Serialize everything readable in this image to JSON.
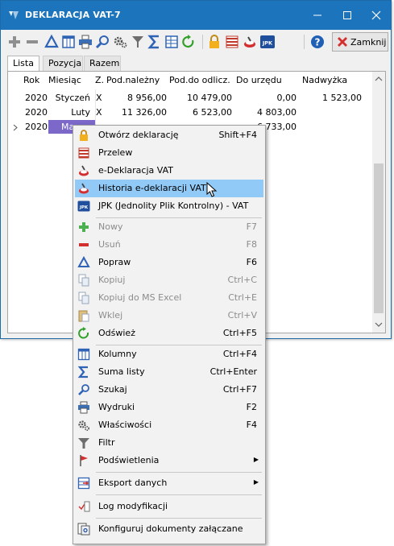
{
  "window": {
    "title": "DEKLARACJA VAT-7",
    "close_label": "Zamknij"
  },
  "tabs": [
    "Lista",
    "Pozycja",
    "Razem"
  ],
  "grid": {
    "columns": [
      "Rok",
      "Miesiąc",
      "Z.",
      "Pod.należny",
      "Pod.do odlicz.",
      "Do urzędu",
      "Nadwyżka"
    ],
    "rows": [
      [
        "2020",
        "Styczeń",
        "X",
        "8 956,00",
        "10 479,00",
        "0,00",
        "1 523,00"
      ],
      [
        "2020",
        "Luty",
        "X",
        "11 326,00",
        "6 523,00",
        "4 803,00",
        ""
      ],
      [
        "2020",
        "Ma",
        "",
        "",
        "",
        "6 733,00",
        ""
      ]
    ]
  },
  "context_menu": {
    "items": [
      {
        "label": "Otwórz deklarację",
        "shortcut": "Shift+F4",
        "icon": "lock-icon"
      },
      {
        "label": "Przelew",
        "shortcut": "",
        "icon": "transfer-icon"
      },
      {
        "label": "e-Deklaracja VAT",
        "shortcut": "",
        "icon": "e-declaration-icon"
      },
      {
        "label": "Historia e-deklaracji VAT",
        "shortcut": "",
        "icon": "history-icon"
      },
      {
        "label": "JPK (Jednolity Plik Kontrolny) - VAT",
        "shortcut": "",
        "icon": "jpk-icon"
      },
      {
        "label": "Nowy",
        "shortcut": "F7",
        "icon": "plus-icon"
      },
      {
        "label": "Usuń",
        "shortcut": "F8",
        "icon": "minus-icon"
      },
      {
        "label": "Popraw",
        "shortcut": "F6",
        "icon": "edit-triangle-icon"
      },
      {
        "label": "Kopiuj",
        "shortcut": "Ctrl+C",
        "icon": "copy-icon"
      },
      {
        "label": "Kopiuj do MS Excel",
        "shortcut": "Ctrl+E",
        "icon": "copy-excel-icon"
      },
      {
        "label": "Wklej",
        "shortcut": "Ctrl+V",
        "icon": "paste-icon"
      },
      {
        "label": "Odśwież",
        "shortcut": "Ctrl+F5",
        "icon": "refresh-icon"
      },
      {
        "label": "Kolumny",
        "shortcut": "Ctrl+F4",
        "icon": "columns-icon"
      },
      {
        "label": "Suma listy",
        "shortcut": "Ctrl+Enter",
        "icon": "sum-icon"
      },
      {
        "label": "Szukaj",
        "shortcut": "Ctrl+F7",
        "icon": "search-icon"
      },
      {
        "label": "Wydruki",
        "shortcut": "F2",
        "icon": "printer-icon"
      },
      {
        "label": "Właściwości",
        "shortcut": "F4",
        "icon": "gear-icon"
      },
      {
        "label": "Filtr",
        "shortcut": "",
        "icon": "filter-icon"
      },
      {
        "label": "Podświetlenia",
        "shortcut": "",
        "icon": "flag-icon"
      },
      {
        "label": "Eksport danych",
        "shortcut": "",
        "icon": "export-icon"
      },
      {
        "label": "Log modyfikacji",
        "shortcut": "",
        "icon": "log-icon"
      },
      {
        "label": "Konfiguruj dokumenty załączane",
        "shortcut": "",
        "icon": "attachments-icon"
      }
    ]
  },
  "colors": {
    "titlebar": "#1c75bc",
    "highlight": "#91c9f7",
    "selected_cell": "#7b68c8"
  }
}
